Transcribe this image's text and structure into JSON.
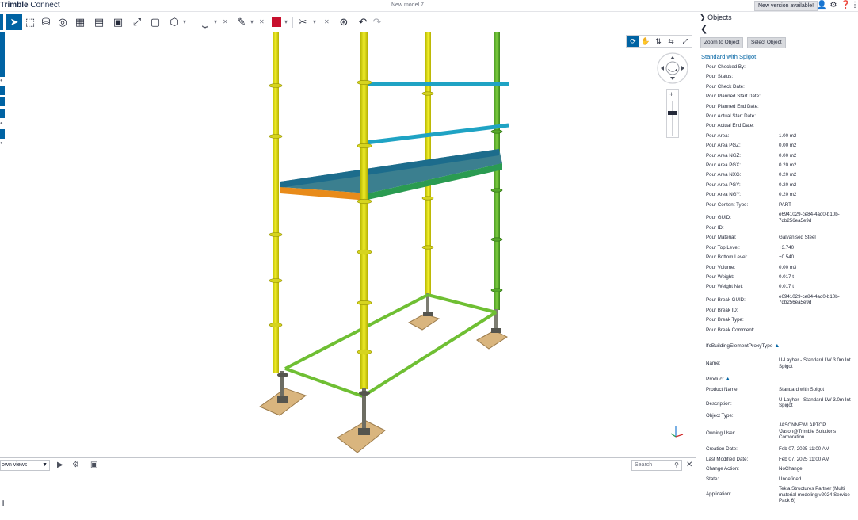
{
  "app": {
    "brand_bold": "Trimble",
    "brand_light": " Connect",
    "model_title": "New model 7",
    "new_version_label": "New version available!"
  },
  "top_icons": [
    "user-icon",
    "gear-icon",
    "help-icon",
    "more-icon"
  ],
  "toolbar": {
    "icons": [
      "cursor-icon",
      "box-select-icon",
      "lasso-select-icon",
      "hide-icon",
      "section-icon",
      "measure-icon",
      "clip-icon",
      "fit-icon",
      "isolate-icon",
      "view-cube-icon",
      "level-icon",
      "markup-pen-icon",
      "color-icon",
      "scissors-icon",
      "filter-icon",
      "undo-icon",
      "redo-icon"
    ],
    "accent": "#0063a3",
    "color_swatch": "#c8102e"
  },
  "bottom": {
    "views_label": "own views",
    "search_placeholder": "Search"
  },
  "panel": {
    "title": "Objects",
    "zoom_button": "Zoom to Object",
    "select_button": "Select Object",
    "object_name": "Standard with Spigot",
    "properties": [
      {
        "label": "Pour Checked By:",
        "value": ""
      },
      {
        "label": "Pour Status:",
        "value": ""
      },
      {
        "label": "Pour Check Date:",
        "value": ""
      },
      {
        "label": "Pour Planned Start Date:",
        "value": ""
      },
      {
        "label": "Pour Planned End Date:",
        "value": ""
      },
      {
        "label": "Pour Actual Start Date:",
        "value": ""
      },
      {
        "label": "Pour Actual End Date:",
        "value": ""
      },
      {
        "label": "Pour Area:",
        "value": "1.00 m2"
      },
      {
        "label": "Pour Area PGZ:",
        "value": "0.00 m2"
      },
      {
        "label": "Pour Area NGZ:",
        "value": "0.00 m2"
      },
      {
        "label": "Pour Area PGX:",
        "value": "0.20 m2"
      },
      {
        "label": "Pour Area NXG:",
        "value": "0.20 m2"
      },
      {
        "label": "Pour Area PGY:",
        "value": "0.20 m2"
      },
      {
        "label": "Pour Area NGY:",
        "value": "0.20 m2"
      },
      {
        "label": "Pour Content Type:",
        "value": "PART"
      },
      {
        "label": "Pour GUID:",
        "value": "e6941029-ce84-4ad0-b10b-7db256ea5e9d"
      },
      {
        "label": "Pour ID:",
        "value": ""
      },
      {
        "label": "Pour Material:",
        "value": "Galvanised Steel"
      },
      {
        "label": "Pour Top Level:",
        "value": "+3.740"
      },
      {
        "label": "Pour Bottom Level:",
        "value": "+0.540"
      },
      {
        "label": "Pour Volume:",
        "value": "0.00 m3"
      },
      {
        "label": "Pour Weight:",
        "value": "0.017 t"
      },
      {
        "label": "Pour Weight Net:",
        "value": "0.017 t"
      },
      {
        "label": "Pour Break GUID:",
        "value": "e6941029-ce84-4ad0-b10b-7db256ea5e9d"
      },
      {
        "label": "Pour Break ID:",
        "value": ""
      },
      {
        "label": "Pour Break Type:",
        "value": ""
      },
      {
        "label": "Pour Break Comment:",
        "value": ""
      }
    ],
    "ifc_section": "IfcBuildingElementProxyType",
    "ifc_name_label": "Name:",
    "ifc_name_value": "U-Layher - Standard LW 3.0m Int Spigot",
    "product_section": "Product",
    "product": [
      {
        "label": "Product Name:",
        "value": "Standard with Spigot"
      },
      {
        "label": "Description:",
        "value": "U-Layher - Standard LW 3.0m Int Spigot"
      },
      {
        "label": "Object Type:",
        "value": ""
      },
      {
        "label": "Owning User:",
        "value": "JASONNEWLAPTOP \\Jason@Trimble Solutions Corporation"
      },
      {
        "label": "Creation Date:",
        "value": "Feb 07, 2025 11:00 AM"
      },
      {
        "label": "Last Modified Date:",
        "value": "Feb 07, 2025 11:00 AM"
      },
      {
        "label": "Change Action:",
        "value": "NoChange"
      },
      {
        "label": "State:",
        "value": "Undefined"
      },
      {
        "label": "Application:",
        "value": "Tekla Structures Partner (Multi material modeling v2024 Service Pack 6)"
      }
    ]
  }
}
